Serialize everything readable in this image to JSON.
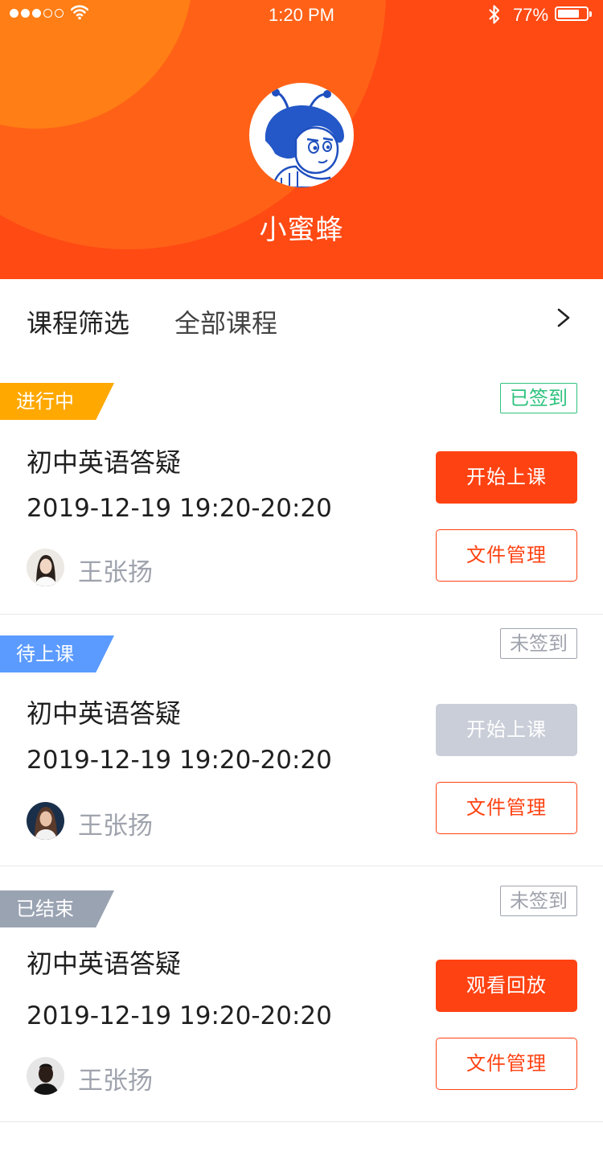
{
  "status_bar": {
    "time": "1:20 PM",
    "battery_pct": "77%",
    "signal_dots": [
      true,
      true,
      true,
      false,
      false
    ],
    "battery_level": 0.77
  },
  "profile": {
    "name": "小蜜蜂",
    "avatar_icon": "cartoon-bee-avatar-icon"
  },
  "filter": {
    "label": "课程筛选",
    "value": "全部课程",
    "arrow_icon": "chevron-right-icon"
  },
  "courses": [
    {
      "status": "进行中",
      "status_color": "#ffa800",
      "sign": "已签到",
      "sign_color": "#2ec27e",
      "title": "初中英语答疑",
      "time": "2019-12-19 19:20-20:20",
      "teacher": "王张扬",
      "primary_action": "开始上课",
      "primary_enabled": true,
      "secondary_action": "文件管理"
    },
    {
      "status": "待上课",
      "status_color": "#5b9bff",
      "sign": "未签到",
      "sign_color": "#9fa3ad",
      "title": "初中英语答疑",
      "time": "2019-12-19 19:20-20:20",
      "teacher": "王张扬",
      "primary_action": "开始上课",
      "primary_enabled": false,
      "secondary_action": "文件管理"
    },
    {
      "status": "已结束",
      "status_color": "#9aa3b2",
      "sign": "未签到",
      "sign_color": "#9fa3ad",
      "title": "初中英语答疑",
      "time": "2019-12-19 19:20-20:20",
      "teacher": "王张扬",
      "primary_action": "观看回放",
      "primary_enabled": true,
      "secondary_action": "文件管理"
    }
  ],
  "colors": {
    "brand": "#ff4212",
    "header_bg": "#ff4a14",
    "disabled_button": "#c9ced8"
  }
}
